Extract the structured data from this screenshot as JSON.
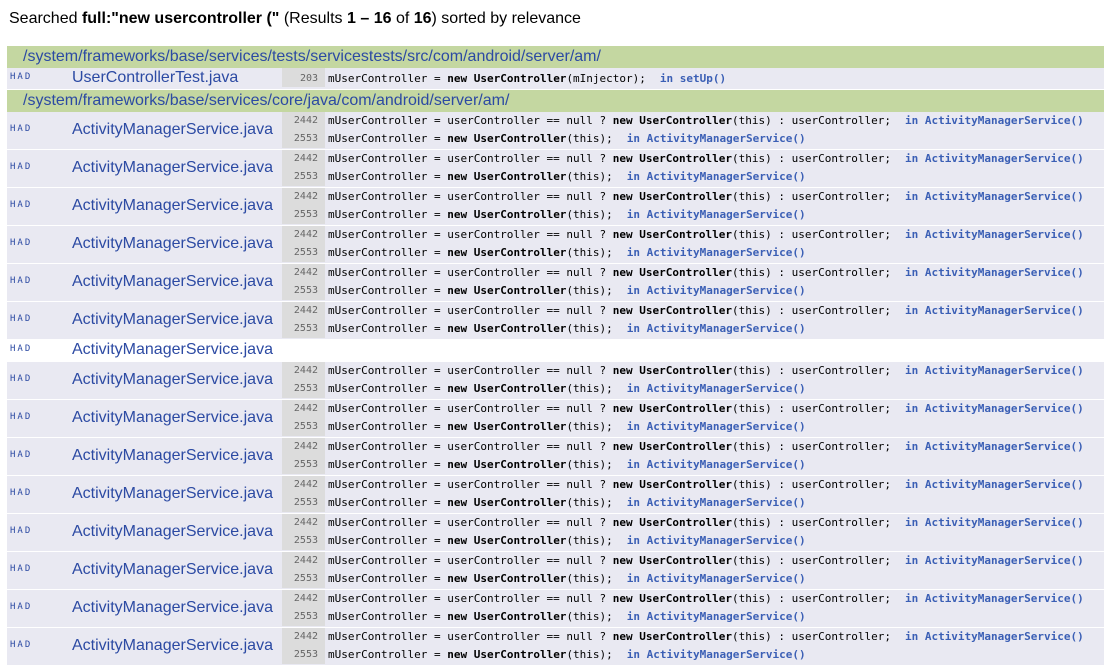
{
  "summary": {
    "prefix": "Searched",
    "query": "full:\"new usercontroller (\"",
    "results_open": "(Results",
    "range_start": "1",
    "dash": "–",
    "range_end": "16",
    "of": "of",
    "total": "16",
    "results_close": ") sorted by relevance"
  },
  "groups": [
    {
      "dir": "/system/frameworks/base/services/tests/servicestests/src/com/android/server/am/",
      "files": [
        {
          "badge": "HAD",
          "name": "UserControllerTest.java",
          "matches": [
            {
              "line": "203",
              "pre": "mUserController = ",
              "kw": "new",
              "mid": " ",
              "hl": "UserController",
              "post": "(mInjector);",
              "scope": "in setUp()"
            }
          ]
        }
      ]
    },
    {
      "dir": "/system/frameworks/base/services/core/java/com/android/server/am/",
      "files": [
        {
          "badge": "HAD",
          "name": "ActivityManagerService.java",
          "matches": [
            {
              "line": "2442",
              "pre": "mUserController = userController == null ? ",
              "kw": "new",
              "mid": " ",
              "hl": "UserController",
              "post": "(this) : userController;",
              "scope": "in ActivityManagerService()"
            },
            {
              "line": "2553",
              "pre": "mUserController = ",
              "kw": "new",
              "mid": " ",
              "hl": "UserController",
              "post": "(this);",
              "scope": "in ActivityManagerService()"
            }
          ]
        },
        {
          "badge": "HAD",
          "name": "ActivityManagerService.java",
          "matches": [
            {
              "line": "2442",
              "pre": "mUserController = userController == null ? ",
              "kw": "new",
              "mid": " ",
              "hl": "UserController",
              "post": "(this) : userController;",
              "scope": "in ActivityManagerService()"
            },
            {
              "line": "2553",
              "pre": "mUserController = ",
              "kw": "new",
              "mid": " ",
              "hl": "UserController",
              "post": "(this);",
              "scope": "in ActivityManagerService()"
            }
          ]
        },
        {
          "badge": "HAD",
          "name": "ActivityManagerService.java",
          "matches": [
            {
              "line": "2442",
              "pre": "mUserController = userController == null ? ",
              "kw": "new",
              "mid": " ",
              "hl": "UserController",
              "post": "(this) : userController;",
              "scope": "in ActivityManagerService()"
            },
            {
              "line": "2553",
              "pre": "mUserController = ",
              "kw": "new",
              "mid": " ",
              "hl": "UserController",
              "post": "(this);",
              "scope": "in ActivityManagerService()"
            }
          ]
        },
        {
          "badge": "HAD",
          "name": "ActivityManagerService.java",
          "matches": [
            {
              "line": "2442",
              "pre": "mUserController = userController == null ? ",
              "kw": "new",
              "mid": " ",
              "hl": "UserController",
              "post": "(this) : userController;",
              "scope": "in ActivityManagerService()"
            },
            {
              "line": "2553",
              "pre": "mUserController = ",
              "kw": "new",
              "mid": " ",
              "hl": "UserController",
              "post": "(this);",
              "scope": "in ActivityManagerService()"
            }
          ]
        },
        {
          "badge": "HAD",
          "name": "ActivityManagerService.java",
          "matches": [
            {
              "line": "2442",
              "pre": "mUserController = userController == null ? ",
              "kw": "new",
              "mid": " ",
              "hl": "UserController",
              "post": "(this) : userController;",
              "scope": "in ActivityManagerService()"
            },
            {
              "line": "2553",
              "pre": "mUserController = ",
              "kw": "new",
              "mid": " ",
              "hl": "UserController",
              "post": "(this);",
              "scope": "in ActivityManagerService()"
            }
          ]
        },
        {
          "badge": "HAD",
          "name": "ActivityManagerService.java",
          "matches": [
            {
              "line": "2442",
              "pre": "mUserController = userController == null ? ",
              "kw": "new",
              "mid": " ",
              "hl": "UserController",
              "post": "(this) : userController;",
              "scope": "in ActivityManagerService()"
            },
            {
              "line": "2553",
              "pre": "mUserController = ",
              "kw": "new",
              "mid": " ",
              "hl": "UserController",
              "post": "(this);",
              "scope": "in ActivityManagerService()"
            }
          ]
        },
        {
          "badge": "HAD",
          "name": "ActivityManagerService.java",
          "matches": []
        },
        {
          "badge": "HAD",
          "name": "ActivityManagerService.java",
          "matches": [
            {
              "line": "2442",
              "pre": "mUserController = userController == null ? ",
              "kw": "new",
              "mid": " ",
              "hl": "UserController",
              "post": "(this) : userController;",
              "scope": "in ActivityManagerService()"
            },
            {
              "line": "2553",
              "pre": "mUserController = ",
              "kw": "new",
              "mid": " ",
              "hl": "UserController",
              "post": "(this);",
              "scope": "in ActivityManagerService()"
            }
          ]
        },
        {
          "badge": "HAD",
          "name": "ActivityManagerService.java",
          "matches": [
            {
              "line": "2442",
              "pre": "mUserController = userController == null ? ",
              "kw": "new",
              "mid": " ",
              "hl": "UserController",
              "post": "(this) : userController;",
              "scope": "in ActivityManagerService()"
            },
            {
              "line": "2553",
              "pre": "mUserController = ",
              "kw": "new",
              "mid": " ",
              "hl": "UserController",
              "post": "(this);",
              "scope": "in ActivityManagerService()"
            }
          ]
        },
        {
          "badge": "HAD",
          "name": "ActivityManagerService.java",
          "matches": [
            {
              "line": "2442",
              "pre": "mUserController = userController == null ? ",
              "kw": "new",
              "mid": " ",
              "hl": "UserController",
              "post": "(this) : userController;",
              "scope": "in ActivityManagerService()"
            },
            {
              "line": "2553",
              "pre": "mUserController = ",
              "kw": "new",
              "mid": " ",
              "hl": "UserController",
              "post": "(this);",
              "scope": "in ActivityManagerService()"
            }
          ]
        },
        {
          "badge": "HAD",
          "name": "ActivityManagerService.java",
          "matches": [
            {
              "line": "2442",
              "pre": "mUserController = userController == null ? ",
              "kw": "new",
              "mid": " ",
              "hl": "UserController",
              "post": "(this) : userController;",
              "scope": "in ActivityManagerService()"
            },
            {
              "line": "2553",
              "pre": "mUserController = ",
              "kw": "new",
              "mid": " ",
              "hl": "UserController",
              "post": "(this);",
              "scope": "in ActivityManagerService()"
            }
          ]
        },
        {
          "badge": "HAD",
          "name": "ActivityManagerService.java",
          "matches": [
            {
              "line": "2442",
              "pre": "mUserController = userController == null ? ",
              "kw": "new",
              "mid": " ",
              "hl": "UserController",
              "post": "(this) : userController;",
              "scope": "in ActivityManagerService()"
            },
            {
              "line": "2553",
              "pre": "mUserController = ",
              "kw": "new",
              "mid": " ",
              "hl": "UserController",
              "post": "(this);",
              "scope": "in ActivityManagerService()"
            }
          ]
        },
        {
          "badge": "HAD",
          "name": "ActivityManagerService.java",
          "matches": [
            {
              "line": "2442",
              "pre": "mUserController = userController == null ? ",
              "kw": "new",
              "mid": " ",
              "hl": "UserController",
              "post": "(this) : userController;",
              "scope": "in ActivityManagerService()"
            },
            {
              "line": "2553",
              "pre": "mUserController = ",
              "kw": "new",
              "mid": " ",
              "hl": "UserController",
              "post": "(this);",
              "scope": "in ActivityManagerService()"
            }
          ]
        },
        {
          "badge": "HAD",
          "name": "ActivityManagerService.java",
          "matches": [
            {
              "line": "2442",
              "pre": "mUserController = userController == null ? ",
              "kw": "new",
              "mid": " ",
              "hl": "UserController",
              "post": "(this) : userController;",
              "scope": "in ActivityManagerService()"
            },
            {
              "line": "2553",
              "pre": "mUserController = ",
              "kw": "new",
              "mid": " ",
              "hl": "UserController",
              "post": "(this);",
              "scope": "in ActivityManagerService()"
            }
          ]
        },
        {
          "badge": "HAD",
          "name": "ActivityManagerService.java",
          "matches": [
            {
              "line": "2442",
              "pre": "mUserController = userController == null ? ",
              "kw": "new",
              "mid": " ",
              "hl": "UserController",
              "post": "(this) : userController;",
              "scope": "in ActivityManagerService()"
            },
            {
              "line": "2553",
              "pre": "mUserController = ",
              "kw": "new",
              "mid": " ",
              "hl": "UserController",
              "post": "(this);",
              "scope": "in ActivityManagerService()"
            }
          ]
        }
      ]
    }
  ],
  "colors": {
    "dir_band": "#c4d7a1",
    "link": "#2c4aa3",
    "row_shade": "#e9e9f2",
    "line_number_bg": "#dcdcdc"
  }
}
